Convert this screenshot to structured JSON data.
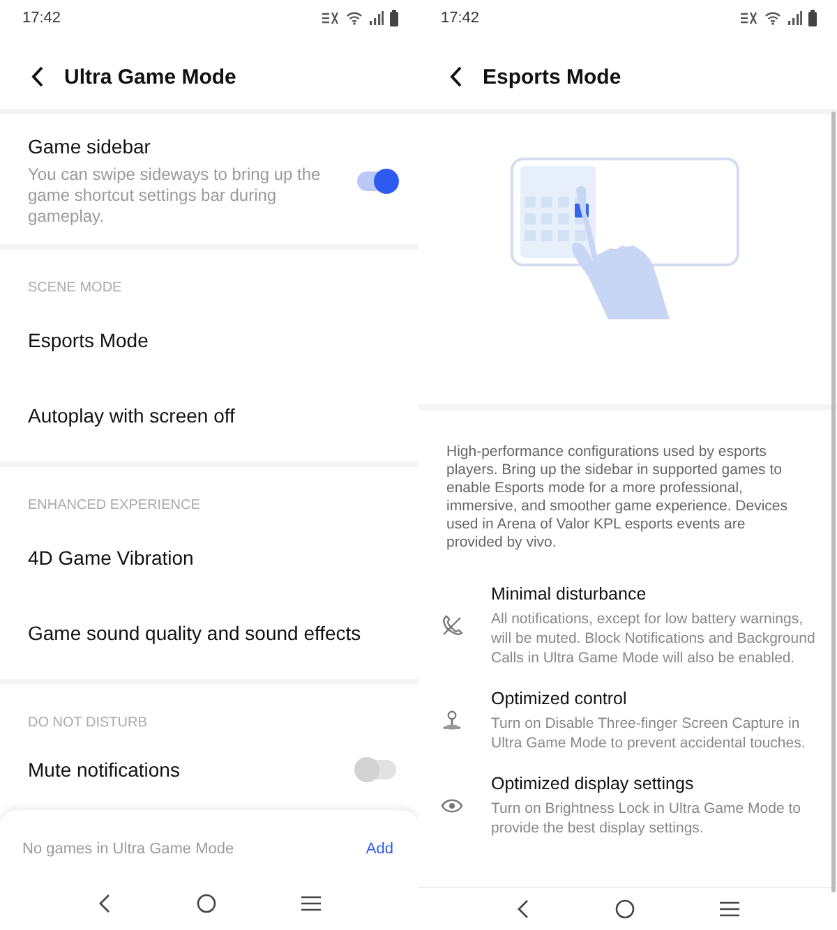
{
  "left": {
    "status_bar": {
      "time": "17:42"
    },
    "header": {
      "title": "Ultra Game Mode"
    },
    "items": [
      {
        "kind": "toggle",
        "title": "Game sidebar",
        "description": "You can swipe sideways to bring up the game shortcut settings bar during gameplay.",
        "on": true
      },
      {
        "kind": "divider"
      },
      {
        "kind": "section",
        "label": "SCENE MODE"
      },
      {
        "kind": "link",
        "title": "Esports Mode"
      },
      {
        "kind": "link",
        "title": "Autoplay with screen off"
      },
      {
        "kind": "divider"
      },
      {
        "kind": "section",
        "label": "ENHANCED EXPERIENCE"
      },
      {
        "kind": "link",
        "title": "4D Game Vibration"
      },
      {
        "kind": "link",
        "title": "Game sound quality and sound effects"
      },
      {
        "kind": "divider"
      },
      {
        "kind": "section",
        "label": "DO NOT DISTURB"
      },
      {
        "kind": "toggle",
        "title": "Mute notifications",
        "on": false
      }
    ],
    "bottom_sheet": {
      "message": "No games in Ultra Game Mode",
      "action": "Add"
    }
  },
  "right": {
    "status_bar": {
      "time": "17:42"
    },
    "header": {
      "title": "Esports Mode"
    },
    "description": "High-performance configurations used by esports players. Bring up the sidebar in supported games to enable Esports mode for a more professional, immersive, and smoother game experience. Devices used in Arena of Valor KPL esports events are provided by vivo.",
    "features": [
      {
        "title": "Minimal disturbance",
        "description": "All notifications, except for low battery warnings, will be muted. Block Notifications and Background Calls in Ultra Game Mode will also be enabled."
      },
      {
        "title": "Optimized control",
        "description": "Turn on Disable Three-finger Screen Capture in Ultra Game Mode to prevent accidental touches."
      },
      {
        "title": "Optimized display settings",
        "description": "Turn on Brightness Lock in Ultra Game Mode to provide the best display settings."
      }
    ]
  }
}
